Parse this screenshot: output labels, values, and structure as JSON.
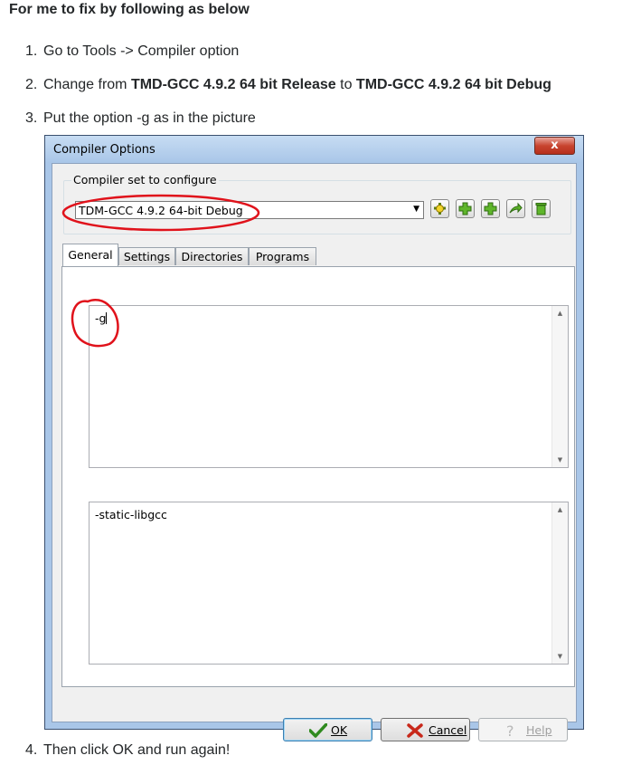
{
  "heading": "For me to fix by following as below",
  "steps": [
    {
      "num": "1.",
      "text": "Go to Tools -> Compiler option"
    },
    {
      "num": "2.",
      "pre": "Change from ",
      "bold1": "TMD-GCC 4.9.2 64 bit Release",
      "mid": " to ",
      "bold2": "TMD-GCC 4.9.2 64 bit Debug"
    },
    {
      "num": "3.",
      "text": "Put the option -g as in the picture"
    },
    {
      "num": "4.",
      "text": "Then click OK and run again!"
    }
  ],
  "dialog": {
    "title": "Compiler Options",
    "close_label": "x",
    "group_label": "Compiler set to configure",
    "compiler_selected": "TDM-GCC 4.9.2 64-bit Debug",
    "toolbar_icons": [
      "find-compilers-icon",
      "add-compiler-icon",
      "add-compiler-icon",
      "rename-compiler-icon",
      "delete-compiler-icon"
    ],
    "tabs": [
      "General",
      "Settings",
      "Directories",
      "Programs"
    ],
    "compiler_options_value": "-g",
    "linker_options_value": "-static-libgcc",
    "buttons": {
      "ok": "OK",
      "cancel": "Cancel",
      "help": "Help"
    }
  },
  "annotation_color": "#e0121b"
}
